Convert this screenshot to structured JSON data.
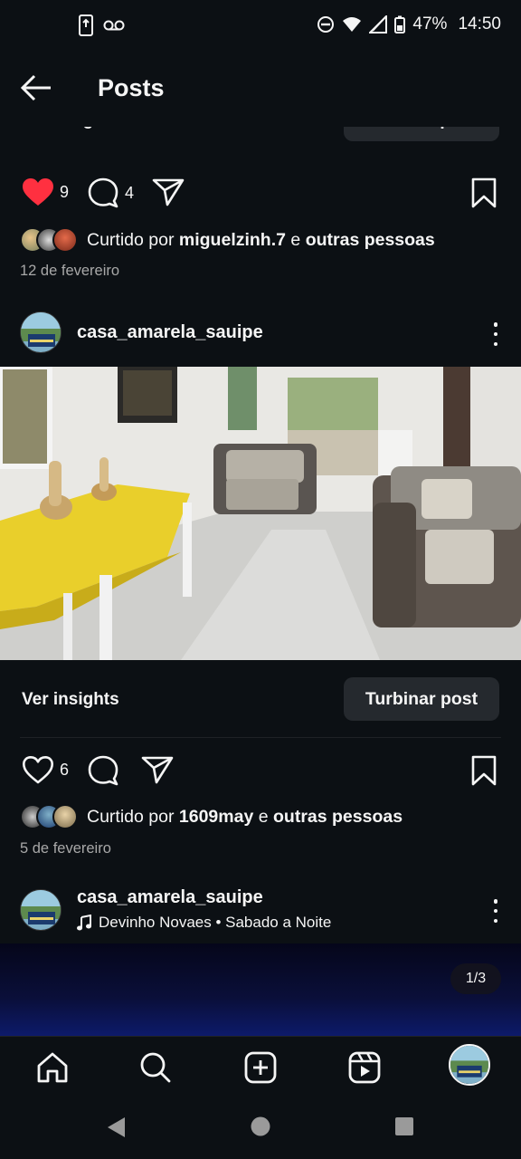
{
  "status_bar": {
    "battery": "47%",
    "time": "14:50",
    "icons": [
      "phone-data-icon",
      "voicemail-icon",
      "dnd-icon",
      "wifi-icon",
      "signal-icon",
      "battery-icon"
    ]
  },
  "header": {
    "title": "Posts",
    "back_icon": "arrow-left-icon"
  },
  "previous_post_clipped": {
    "insights_label": "Ver insights",
    "boost_label": "Turbinar post"
  },
  "posts": [
    {
      "like_count": "9",
      "liked": true,
      "comment_count": "4",
      "liked_by_prefix": "Curtido por ",
      "liked_by_user": "miguelzinh.7",
      "liked_by_connector": " e ",
      "liked_by_suffix": "outras pessoas",
      "date": "12 de fevereiro"
    },
    {
      "username": "casa_amarela_sauipe",
      "insights_label": "Ver insights",
      "boost_label": "Turbinar post",
      "like_count": "6",
      "liked": false,
      "liked_by_prefix": "Curtido por ",
      "liked_by_user": "1609may",
      "liked_by_connector": " e ",
      "liked_by_suffix": "outras pessoas",
      "date": "5 de fevereiro"
    },
    {
      "username": "casa_amarela_sauipe",
      "music": "Devinho Novaes • Sabado a Noite",
      "pager": "1/3"
    }
  ],
  "bottom_nav": [
    "home-icon",
    "search-icon",
    "create-icon",
    "reels-icon",
    "profile-avatar"
  ],
  "system_nav": [
    "back-triangle-icon",
    "home-circle-icon",
    "recents-square-icon"
  ],
  "colors": {
    "background": "#0c1014",
    "text": "#f5f5f5",
    "secondary_text": "#a8a8a8",
    "like_red": "#ff3040",
    "button_bg": "#25292e"
  }
}
